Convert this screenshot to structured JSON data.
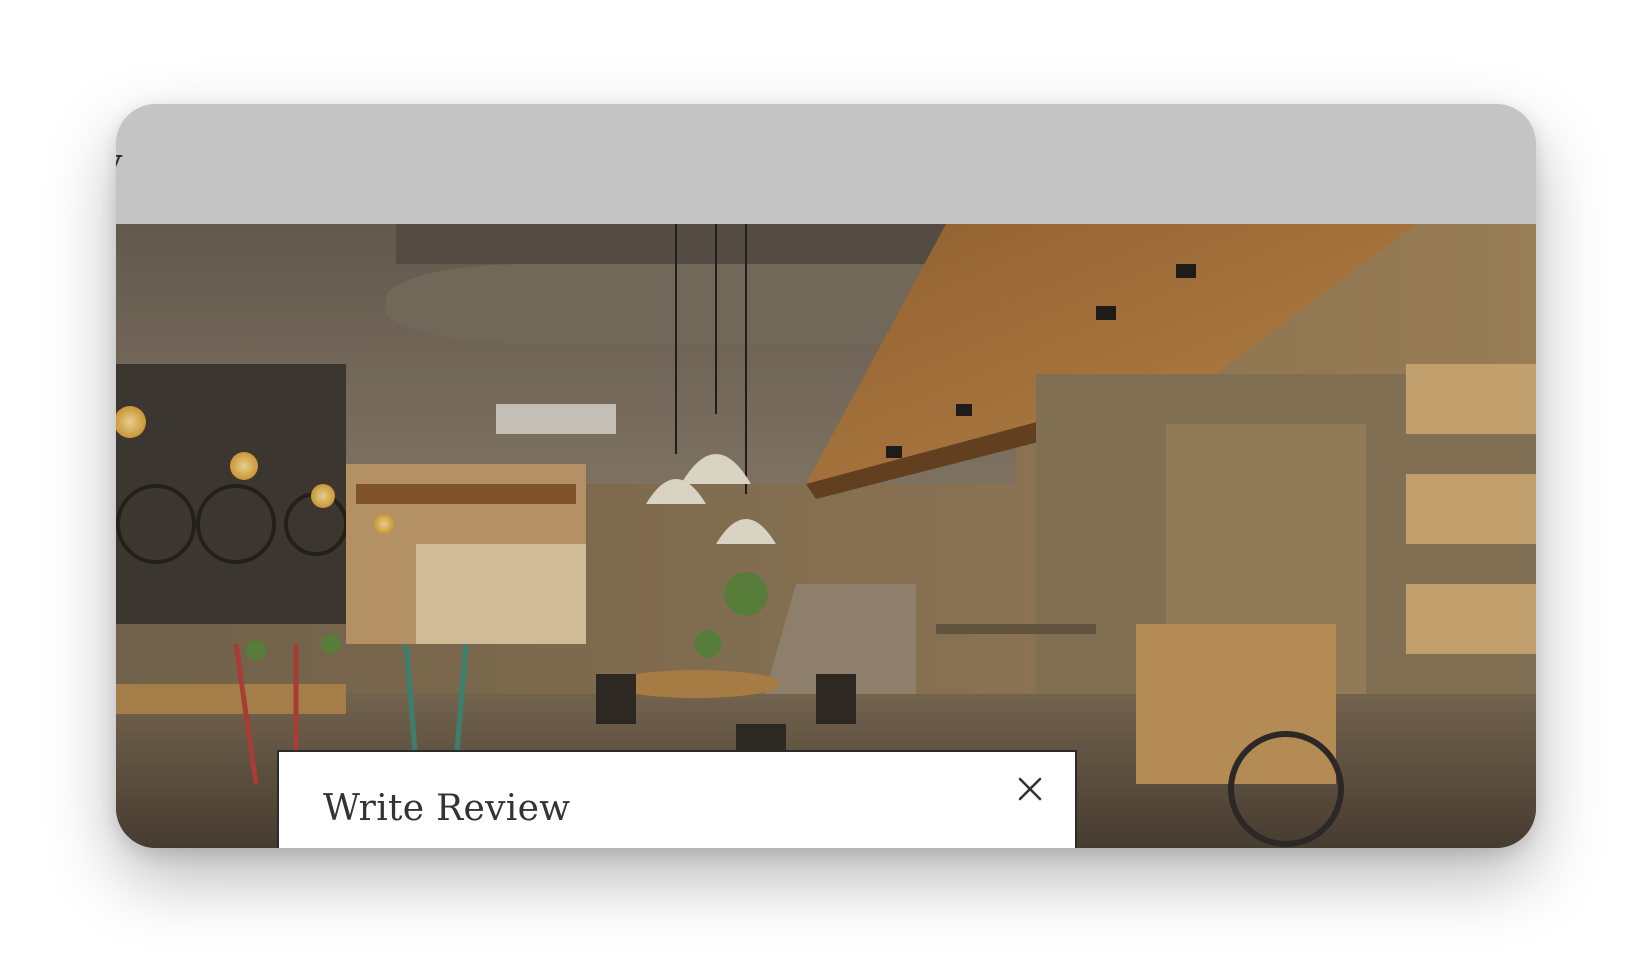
{
  "top_bar": {
    "edge_glyph": "y"
  },
  "hero": {
    "image": "restaurant-interior-photo"
  },
  "modal": {
    "title": "Write Review",
    "close_icon": "close-icon"
  },
  "colors": {
    "header_gray": "#c4c4c4",
    "modal_bg": "#ffffff",
    "title_text": "#333333"
  }
}
